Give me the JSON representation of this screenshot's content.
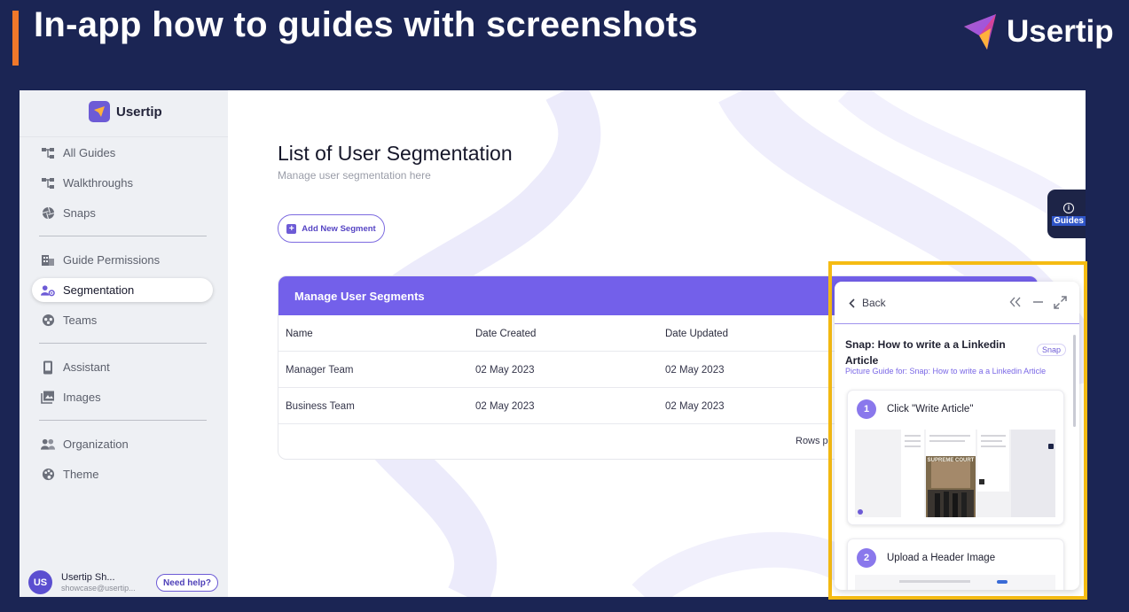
{
  "banner": {
    "title": "In-app how to guides with screenshots",
    "brand": "Usertip",
    "colors": {
      "background": "#1b2554",
      "accent_bar": "#f0782a"
    }
  },
  "app": {
    "logo_text": "Usertip",
    "sidebar": {
      "items": [
        {
          "label": "All Guides",
          "icon": "sitemap-icon"
        },
        {
          "label": "Walkthroughs",
          "icon": "sitemap-icon"
        },
        {
          "label": "Snaps",
          "icon": "aperture-icon"
        },
        {
          "label": "Guide Permissions",
          "icon": "building-icon"
        },
        {
          "label": "Segmentation",
          "icon": "users-cog-icon",
          "active": true
        },
        {
          "label": "Teams",
          "icon": "team-icon"
        },
        {
          "label": "Assistant",
          "icon": "tablet-icon"
        },
        {
          "label": "Images",
          "icon": "image-icon"
        },
        {
          "label": "Organization",
          "icon": "people-icon"
        },
        {
          "label": "Theme",
          "icon": "palette-icon"
        }
      ],
      "user": {
        "initials": "US",
        "name": "Usertip Sh...",
        "email": "showcase@usertip...",
        "help_label": "Need help?"
      }
    },
    "main": {
      "title": "List of User Segmentation",
      "subtitle": "Manage user segmentation here",
      "add_button_label": "Add New Segment",
      "table": {
        "header": "Manage User Segments",
        "columns": [
          "Name",
          "Date Created",
          "Date Updated"
        ],
        "rows": [
          [
            "Manager Team",
            "02 May 2023",
            "02 May 2023"
          ],
          [
            "Business Team",
            "02 May 2023",
            "02 May 2023"
          ]
        ],
        "footer_text": "Rows p"
      },
      "guides_tab_label": "Guides"
    },
    "guide_panel": {
      "back_label": "Back",
      "title": "Snap: How to write a a Linkedin Article",
      "badge": "Snap",
      "subtitle": "Picture Guide for: Snap: How to write a a Linkedin Article",
      "steps": [
        {
          "number": "1",
          "label": "Click \"Write Article\""
        },
        {
          "number": "2",
          "label": "Upload a Header Image"
        }
      ],
      "screenshot_caption": "SUPREME COURT"
    },
    "colors": {
      "primary": "#7360ea",
      "highlight": "#f5bb13",
      "sidebar_bg": "#eef0f4"
    }
  }
}
